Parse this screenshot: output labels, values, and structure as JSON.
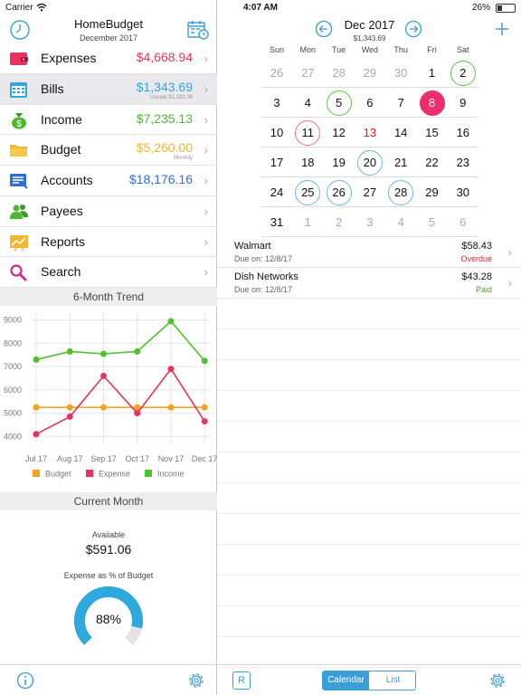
{
  "status_bar": {
    "carrier": "Carrier",
    "time": "4:07 AM",
    "battery": "26%"
  },
  "left_header": {
    "title": "HomeBudget",
    "subtitle": "December 2017"
  },
  "menu": [
    {
      "label": "Expenses",
      "value": "$4,668.94",
      "color": "#e8335f",
      "note": "",
      "icon": "wallet-icon"
    },
    {
      "label": "Bills",
      "value": "$1,343.69",
      "color": "#2fa8dd",
      "note": "Unpaid $1,182.38",
      "icon": "calendar-icon"
    },
    {
      "label": "Income",
      "value": "$7,235.13",
      "color": "#4cb831",
      "note": "",
      "icon": "money-bag-icon"
    },
    {
      "label": "Budget",
      "value": "$5,260.00",
      "color": "#f2b630",
      "note": "Monthly",
      "icon": "folder-icon"
    },
    {
      "label": "Accounts",
      "value": "$18,176.16",
      "color": "#2f6fd8",
      "note": "",
      "icon": "accounts-icon"
    },
    {
      "label": "Payees",
      "value": "",
      "color": "",
      "note": "",
      "icon": "people-icon"
    },
    {
      "label": "Reports",
      "value": "",
      "color": "",
      "note": "",
      "icon": "reports-icon"
    },
    {
      "label": "Search",
      "value": "",
      "color": "",
      "note": "",
      "icon": "search-icon"
    }
  ],
  "trend": {
    "heading": "6-Month Trend",
    "chart_data": {
      "type": "line",
      "categories": [
        "Jul 17",
        "Aug 17",
        "Sep 17",
        "Oct 17",
        "Nov 17",
        "Dec 17"
      ],
      "ylim": [
        3700,
        9300
      ],
      "yticks": [
        4000,
        5000,
        6000,
        7000,
        8000,
        9000
      ],
      "grid": true,
      "legend_position": "bottom",
      "series": [
        {
          "name": "Budget",
          "color": "#f5a21c",
          "values": [
            5250,
            5250,
            5250,
            5250,
            5250,
            5250
          ]
        },
        {
          "name": "Expense",
          "color": "#e8335f",
          "values": [
            4100,
            4850,
            6600,
            5000,
            6900,
            4650
          ]
        },
        {
          "name": "Income",
          "color": "#4cc22b",
          "values": [
            7300,
            7650,
            7550,
            7650,
            8950,
            7250
          ]
        }
      ]
    }
  },
  "current_month": {
    "heading": "Current Month",
    "available_label": "Available",
    "available_value": "$591.06",
    "expense_label": "Expense as % of Budget",
    "expense_pct": "88%",
    "expense_fraction": 0.88,
    "ring_color": "#2fa8dd"
  },
  "right_header": {
    "month": "Dec 2017",
    "total": "$1,343.69"
  },
  "calendar": {
    "weekdays": [
      "Sun",
      "Mon",
      "Tue",
      "Wed",
      "Thu",
      "Fri",
      "Sat"
    ],
    "weeks": [
      [
        {
          "d": "26",
          "s": "muted"
        },
        {
          "d": "27",
          "s": "muted"
        },
        {
          "d": "28",
          "s": "muted"
        },
        {
          "d": "29",
          "s": "muted"
        },
        {
          "d": "30",
          "s": "muted"
        },
        {
          "d": "1",
          "s": ""
        },
        {
          "d": "2",
          "s": "ring-green"
        }
      ],
      [
        {
          "d": "3",
          "s": ""
        },
        {
          "d": "4",
          "s": ""
        },
        {
          "d": "5",
          "s": "ring-green"
        },
        {
          "d": "6",
          "s": ""
        },
        {
          "d": "7",
          "s": ""
        },
        {
          "d": "8",
          "s": "fill-red"
        },
        {
          "d": "9",
          "s": ""
        }
      ],
      [
        {
          "d": "10",
          "s": ""
        },
        {
          "d": "11",
          "s": "ring-red"
        },
        {
          "d": "12",
          "s": ""
        },
        {
          "d": "13",
          "s": "red"
        },
        {
          "d": "14",
          "s": ""
        },
        {
          "d": "15",
          "s": ""
        },
        {
          "d": "16",
          "s": ""
        }
      ],
      [
        {
          "d": "17",
          "s": ""
        },
        {
          "d": "18",
          "s": ""
        },
        {
          "d": "19",
          "s": ""
        },
        {
          "d": "20",
          "s": "ring-blue"
        },
        {
          "d": "21",
          "s": ""
        },
        {
          "d": "22",
          "s": ""
        },
        {
          "d": "23",
          "s": ""
        }
      ],
      [
        {
          "d": "24",
          "s": ""
        },
        {
          "d": "25",
          "s": "ring-blue"
        },
        {
          "d": "26",
          "s": "ring-blue"
        },
        {
          "d": "27",
          "s": ""
        },
        {
          "d": "28",
          "s": "ring-blue"
        },
        {
          "d": "29",
          "s": ""
        },
        {
          "d": "30",
          "s": ""
        }
      ],
      [
        {
          "d": "31",
          "s": ""
        },
        {
          "d": "1",
          "s": "muted"
        },
        {
          "d": "2",
          "s": "muted"
        },
        {
          "d": "3",
          "s": "muted"
        },
        {
          "d": "4",
          "s": "muted"
        },
        {
          "d": "5",
          "s": "muted"
        },
        {
          "d": "6",
          "s": "muted"
        }
      ]
    ]
  },
  "bills": [
    {
      "payee": "Walmart",
      "due": "Due on: 12/8/17",
      "amount": "$58.43",
      "status": "Overdue",
      "status_color": "#d9262e"
    },
    {
      "payee": "Dish Networks",
      "due": "Due on: 12/8/17",
      "amount": "$43.28",
      "status": "Paid",
      "status_color": "#4e9a2a"
    }
  ],
  "footer": {
    "r_label": "R",
    "tab_calendar": "Calendar",
    "tab_list": "List"
  },
  "accent": "#3a9fd6"
}
